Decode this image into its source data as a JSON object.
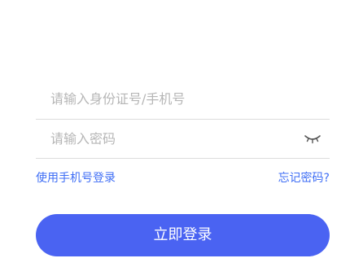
{
  "form": {
    "id_field": {
      "placeholder": "请输入身份证号/手机号",
      "value": ""
    },
    "password_field": {
      "placeholder": "请输入密码",
      "value": "",
      "toggle_icon": "eye-closed-icon"
    }
  },
  "links": {
    "phone_login": "使用手机号登录",
    "forgot_password": "忘记密码?"
  },
  "actions": {
    "login_label": "立即登录"
  },
  "colors": {
    "accent": "#4a63f2",
    "link": "#3f6ef5",
    "placeholder": "#b6b6b6",
    "divider": "#dcdcdc"
  }
}
